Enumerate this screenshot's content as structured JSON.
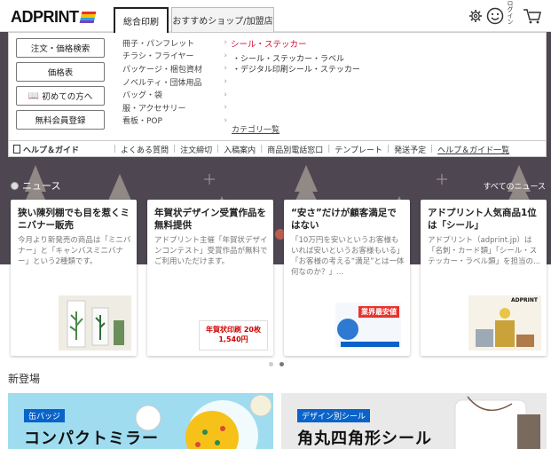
{
  "header": {
    "logo_text": "ADPRINT",
    "tabs": [
      {
        "label": "総合印刷",
        "active": true
      },
      {
        "label": "おすすめショップ/加盟店",
        "active": false
      }
    ],
    "icons": [
      "gear-icon",
      "smiley-icon",
      "cart-icon"
    ],
    "account_label": "ログイン"
  },
  "menu": {
    "buttons": [
      {
        "label": "注文・価格検索"
      },
      {
        "label": "価格表"
      },
      {
        "label": "初めての方へ",
        "icon": "book-icon"
      },
      {
        "label": "無料会員登録"
      }
    ],
    "categories": [
      "冊子・パンフレット",
      "チラシ・フライヤー",
      "パッケージ・梱包資材",
      "ノベルティ・団体用品",
      "バッグ・袋",
      "服・アクセサリー",
      "看板・POP"
    ],
    "subcategory": {
      "title": "シール・ステッカー",
      "items": [
        "・シール・ステッカー・ラベル",
        "・デジタル印刷シール・ステッカー"
      ]
    },
    "category_link": "カテゴリ一覧",
    "help_bar": {
      "title": "ヘルプ＆ガイド",
      "links": [
        "よくある質問",
        "注文締切",
        "入稿案内",
        "商品別電話窓口",
        "テンプレート",
        "発送予定"
      ],
      "all_link": "ヘルプ＆ガイド一覧"
    }
  },
  "news": {
    "title": "ニュース",
    "all_link": "すべてのニュース",
    "cards": [
      {
        "title": "狭い陳列棚でも目を惹くミニバナー販売",
        "body": "今月より新発売の商品は「ミニバナー」と「キャンバスミニバナー」という2種類です。"
      },
      {
        "title": "年賀状デザイン受賞作品を無料提供",
        "body": "アドプリント主催「年賀状デザインコンテスト」受賞作品が無料でご利用いただけます。",
        "image_text": "年賀状印刷 20枚1,540円"
      },
      {
        "title": "“安さ”だけが顧客満足ではない",
        "body": "「10万円を安いというお客様もいれば安いというお客様もいる」「お客様の考える“満足”とは一体何なのか？」...",
        "image_text": "業界最安値"
      },
      {
        "title": "アドプリント人気商品1位は「シール」",
        "body": "アドプリント（adprint.jp）は「名刺・カード類」「シール・ステッカー・ラベル類」を担当の...",
        "image_text": "ADPRINT"
      }
    ],
    "carousel": {
      "total": 2,
      "active": 2
    }
  },
  "new_arrivals": {
    "title": "新登場",
    "banners": [
      {
        "tag": "缶バッジ",
        "text": "コンパクトミラー",
        "bg": "#9fdcf0"
      },
      {
        "tag": "デザイン別シール",
        "text": "角丸四角形シール",
        "bg": "#e9e9e9"
      }
    ]
  },
  "colors": {
    "hero_bg": "#4e4752",
    "accent_red": "#d0103a",
    "tag_blue": "#0a63c9"
  }
}
